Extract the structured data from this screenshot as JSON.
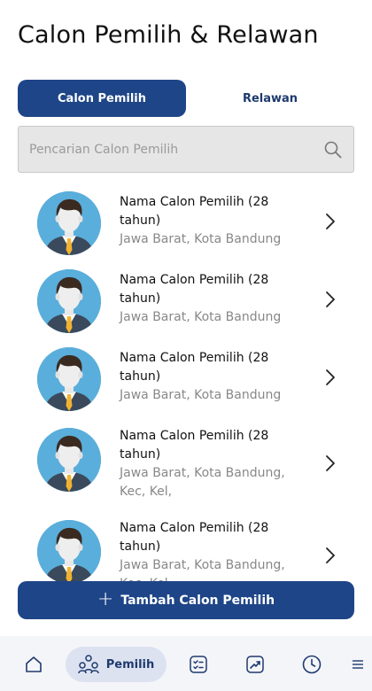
{
  "page": {
    "title": "Calon Pemilih & Relawan"
  },
  "tabs": [
    {
      "label": "Calon Pemilih",
      "active": true
    },
    {
      "label": "Relawan",
      "active": false
    }
  ],
  "search": {
    "placeholder": "Pencarian Calon Pemilih",
    "value": ""
  },
  "voters": [
    {
      "name": "Nama Calon Pemilih (28 tahun)",
      "location": "Jawa Barat, Kota Bandung"
    },
    {
      "name": "Nama Calon Pemilih (28 tahun)",
      "location": "Jawa Barat, Kota Bandung"
    },
    {
      "name": "Nama Calon Pemilih (28 tahun)",
      "location": "Jawa Barat, Kota Bandung"
    },
    {
      "name": "Nama Calon Pemilih (28 tahun)",
      "location": "Jawa Barat, Kota Bandung, Kec, Kel,"
    },
    {
      "name": "Nama Calon Pemilih (28 tahun)",
      "location": "Jawa Barat, Kota Bandung, Kec, Kel,"
    }
  ],
  "add_button": {
    "label": "Tambah Calon Pemilih",
    "icon": "plus-icon"
  },
  "bottom_nav": {
    "items": [
      {
        "icon": "home-icon",
        "label": ""
      },
      {
        "icon": "people-network-icon",
        "label": "Pemilih",
        "active": true
      },
      {
        "icon": "checklist-icon",
        "label": ""
      },
      {
        "icon": "trend-chart-icon",
        "label": ""
      },
      {
        "icon": "clock-icon",
        "label": ""
      },
      {
        "icon": "menu-icon",
        "label": ""
      }
    ]
  },
  "colors": {
    "primary": "#1e4587",
    "avatar_bg": "#5aaedb",
    "nav_bg": "#f4f5f9",
    "nav_active_bg": "#dde2f0"
  }
}
